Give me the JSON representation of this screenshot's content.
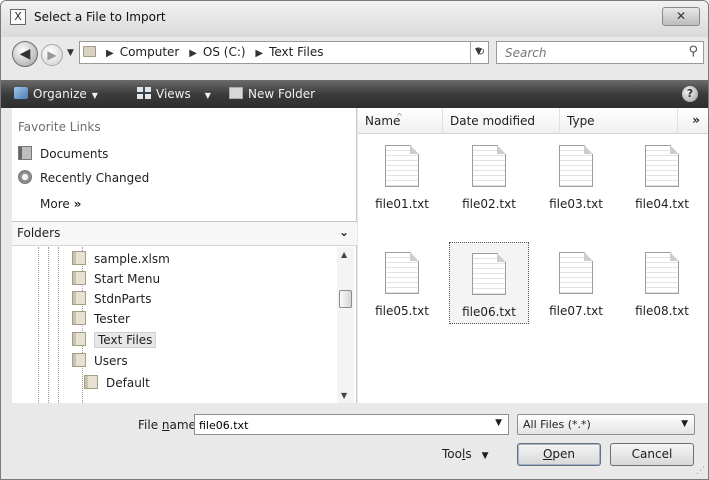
{
  "window": {
    "title": "Select a File to Import",
    "close_label": "✕"
  },
  "address": {
    "crumbs": [
      "Computer",
      "OS (C:)",
      "Text Files"
    ],
    "search_placeholder": "Search"
  },
  "toolbar": {
    "organize_label": "Organize",
    "views_label": "Views",
    "new_folder_label": "New Folder",
    "help_label": "?"
  },
  "favorites": {
    "header": "Favorite Links",
    "items": [
      {
        "label": "Documents",
        "icon": "documents-icon"
      },
      {
        "label": "Recently Changed",
        "icon": "recently-changed-icon"
      }
    ],
    "more_label": "More",
    "more_glyph": "»"
  },
  "folders": {
    "header": "Folders",
    "tree": [
      {
        "label": "sample.xlsm",
        "level": 1
      },
      {
        "label": "Start Menu",
        "level": 1
      },
      {
        "label": "StdnParts",
        "level": 1
      },
      {
        "label": "Tester",
        "level": 1
      },
      {
        "label": "Text Files",
        "level": 1,
        "selected": true
      },
      {
        "label": "Users",
        "level": 1
      },
      {
        "label": "Default",
        "level": 2
      }
    ]
  },
  "columns": {
    "headers": [
      "Name",
      "Date modified",
      "Type"
    ],
    "more_glyph": "»"
  },
  "files": [
    {
      "name": "file01.txt"
    },
    {
      "name": "file02.txt"
    },
    {
      "name": "file03.txt"
    },
    {
      "name": "file04.txt"
    },
    {
      "name": "file05.txt"
    },
    {
      "name": "file06.txt",
      "selected": true
    },
    {
      "name": "file07.txt"
    },
    {
      "name": "file08.txt"
    }
  ],
  "bottom": {
    "file_name_label_pre": "File ",
    "file_name_label_u": "n",
    "file_name_label_post": "ame:",
    "file_name_value": "file06.txt",
    "filter_value": "All Files (*.*)",
    "tools_label_pre": "Too",
    "tools_label_u": "l",
    "tools_label_post": "s",
    "open_label_u": "O",
    "open_label_post": "pen",
    "cancel_label": "Cancel"
  }
}
